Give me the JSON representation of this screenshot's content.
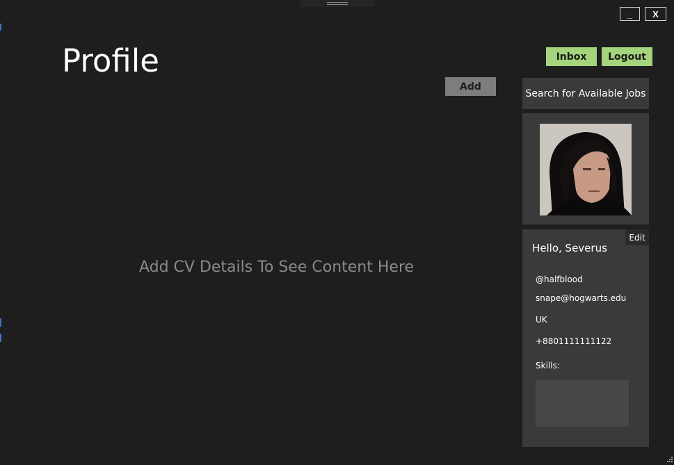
{
  "window": {
    "minimize_label": "_",
    "close_label": "X"
  },
  "header": {
    "title": "Profile",
    "inbox_label": "Inbox",
    "logout_label": "Logout"
  },
  "main": {
    "add_label": "Add",
    "empty_message": "Add CV Details To See Content Here"
  },
  "sidebar": {
    "search_jobs_label": "Search for Available Jobs",
    "edit_label": "Edit",
    "greeting": "Hello, Severus",
    "username": "@halfblood",
    "email": "snape@hogwarts.edu",
    "country": "UK",
    "phone": "+8801111111122",
    "skills_label": "Skills:"
  },
  "colors": {
    "background": "#1e1e1e",
    "accent_green": "#a4d47c",
    "panel": "#3a3a3a"
  }
}
